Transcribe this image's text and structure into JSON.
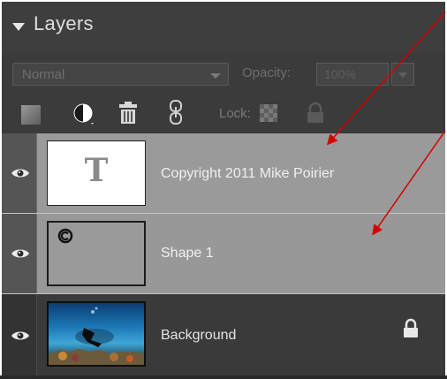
{
  "panel": {
    "title": "Layers",
    "blend_mode": "Normal",
    "opacity_label": "Opacity:",
    "opacity_value": "100%",
    "lock_label": "Lock:"
  },
  "layers": [
    {
      "name": "Copyright 2011 Mike Poirier",
      "thumbnail_glyph": "T"
    },
    {
      "name": "Shape 1"
    },
    {
      "name": "Background"
    }
  ],
  "colors": {
    "panel_bg": "#3b3b3b",
    "selected_row": "#9a9a9a",
    "annotation_arrow": "#d40000"
  },
  "icons": [
    "collapse-triangle-icon",
    "new-layer-icon",
    "adjustment-layer-icon",
    "trash-icon",
    "link-icon",
    "lock-transparent-icon",
    "lock-all-icon",
    "eye-icon",
    "padlock-icon"
  ]
}
